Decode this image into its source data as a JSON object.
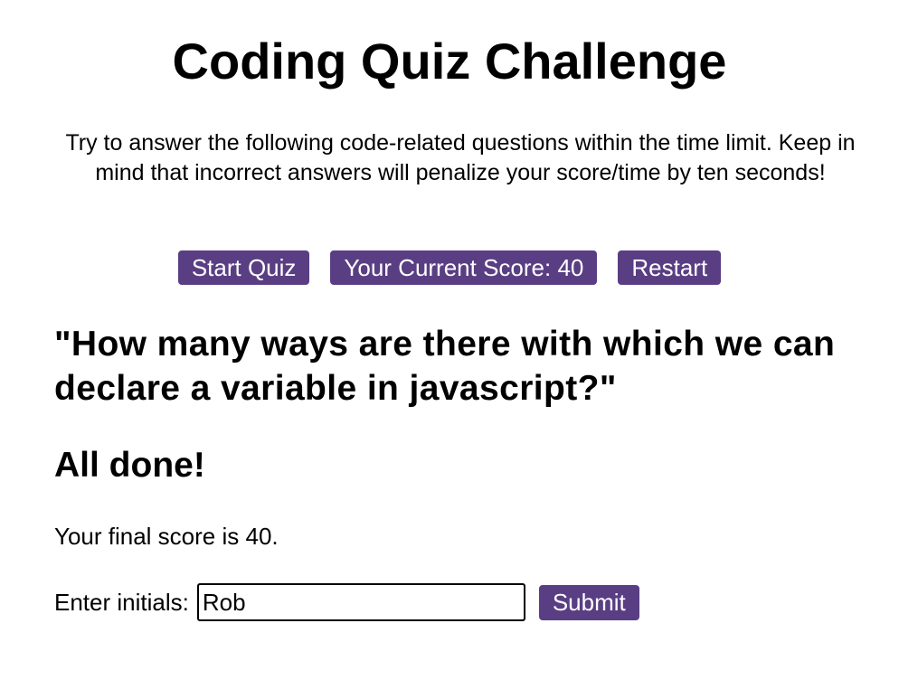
{
  "header": {
    "title": "Coding Quiz Challenge",
    "intro": "Try to answer the following code-related questions within the time limit. Keep in mind that incorrect answers will penalize your score/time by ten seconds!"
  },
  "controls": {
    "start_label": "Start Quiz",
    "score_label": "Your Current Score: 40",
    "restart_label": "Restart"
  },
  "quiz": {
    "question": "\"How many ways are there with which we can declare a variable in javascript?\""
  },
  "results": {
    "heading": "All done!",
    "final_score_text": "Your final score is 40.",
    "initials_label": "Enter initials:",
    "initials_value": "Rob",
    "submit_label": "Submit"
  },
  "colors": {
    "button_bg": "#5a3e83",
    "button_text": "#ffffff"
  }
}
